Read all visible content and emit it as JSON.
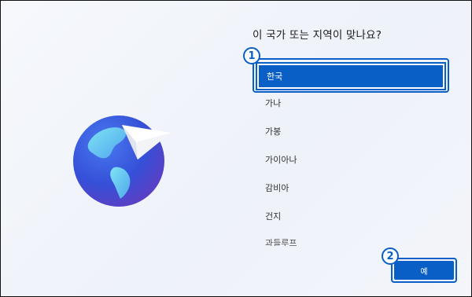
{
  "question": "이 국가 또는 지역이 맞나요?",
  "regions": [
    {
      "label": "한국",
      "selected": true
    },
    {
      "label": "가나",
      "selected": false
    },
    {
      "label": "가봉",
      "selected": false
    },
    {
      "label": "가이아나",
      "selected": false
    },
    {
      "label": "감비아",
      "selected": false
    },
    {
      "label": "건지",
      "selected": false
    },
    {
      "label": "과들루프",
      "selected": false
    }
  ],
  "badges": {
    "first": "1",
    "second": "2"
  },
  "yes_button": "예",
  "colors": {
    "accent": "#0a5fc7",
    "globe": "#3a5fe0",
    "land": "#6ad0f0"
  }
}
